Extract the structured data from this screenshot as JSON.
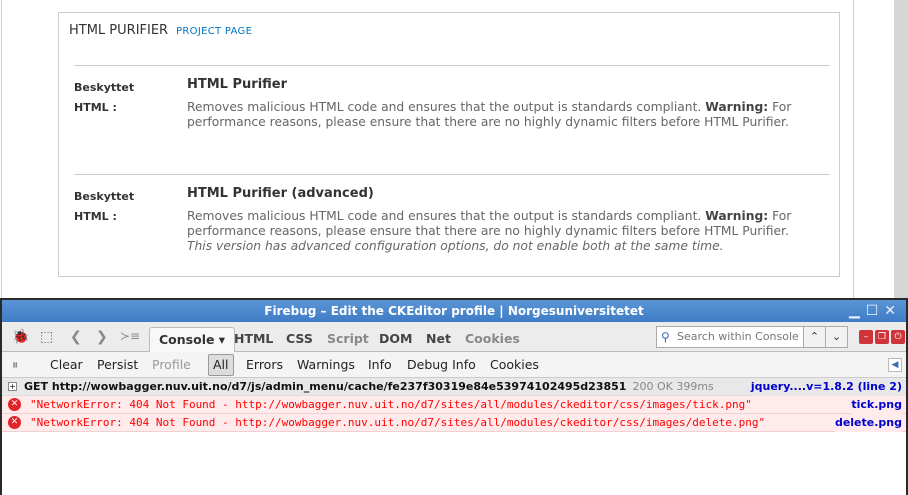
{
  "page": {
    "fieldset_title": "HTML PURIFIER",
    "project_link": "PROJECT PAGE",
    "filters": [
      {
        "label1": "Beskyttet",
        "label2": "HTML :",
        "name": "HTML Purifier",
        "desc": "Removes malicious HTML code and ensures that the output is standards compliant.",
        "warning_label": "Warning:",
        "warning_text": "For performance reasons, please ensure that there are no highly dynamic filters before HTML Purifier.",
        "note": ""
      },
      {
        "label1": "Beskyttet",
        "label2": "HTML :",
        "name": "HTML Purifier (advanced)",
        "desc": "Removes malicious HTML code and ensures that the output is standards compliant.",
        "warning_label": "Warning:",
        "warning_text": "For performance reasons, please ensure that there are no highly dynamic filters before HTML Purifier.",
        "note": "This version has advanced configuration options, do not enable both at the same time."
      }
    ]
  },
  "firebug": {
    "title": "Firebug – Edit the CKEditor profile | Norgesuniversitetet",
    "tabs": [
      "Console",
      "HTML",
      "CSS",
      "Script",
      "DOM",
      "Net",
      "Cookies"
    ],
    "search_placeholder": "Search within Console panel",
    "console_buttons": [
      "Clear",
      "Persist",
      "Profile",
      "All",
      "Errors",
      "Warnings",
      "Info",
      "Debug Info",
      "Cookies"
    ],
    "rows": [
      {
        "type": "get",
        "text": "GET http://wowbagger.nuv.uit.no/d7/js/admin_menu/cache/fe237f30319e84e53974102495d23851",
        "status": "200 OK 399ms",
        "source": "jquery....v=1.8.2 (line 2)"
      },
      {
        "type": "error",
        "text": "\"NetworkError: 404 Not Found - http://wowbagger.nuv.uit.no/d7/sites/all/modules/ckeditor/css/images/tick.png\"",
        "source": "tick.png"
      },
      {
        "type": "error",
        "text": "\"NetworkError: 404 Not Found - http://wowbagger.nuv.uit.no/d7/sites/all/modules/ckeditor/css/images/delete.png\"",
        "source": "delete.png"
      }
    ]
  }
}
